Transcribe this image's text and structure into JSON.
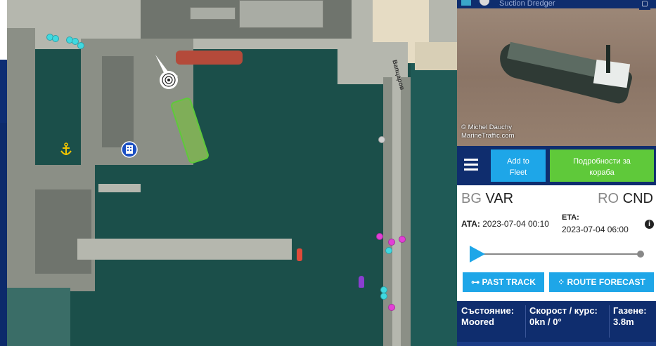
{
  "vessel": {
    "type_label": "Suction Dredger",
    "photo_credit": [
      "© Michel Dauchy",
      "MarineTraffic.com"
    ]
  },
  "actions": {
    "add_to_fleet": [
      "Add to",
      "Fleet"
    ],
    "details": [
      "Подробности за",
      "кораба"
    ],
    "past_track": "PAST TRACK",
    "route_forecast": "ROUTE FORECAST"
  },
  "route": {
    "from_country": "BG",
    "from_port": "VAR",
    "to_country": "RO",
    "to_port": "CND",
    "ata_label": "ATA:",
    "ata_value": "2023-07-04 00:10",
    "eta_label": "ETA:",
    "eta_value": "2023-07-04 06:00",
    "progress": 0.0
  },
  "status": {
    "state_label": "Състояние:",
    "state_value": "Moored",
    "speed_label": "Скорост / курс:",
    "speed_value": "0kn / 0°",
    "draught_label": "Газене:",
    "draught_value": "3.8m"
  },
  "map": {
    "road_label": "Вапцаров"
  },
  "colors": {
    "accent_blue": "#1ea6e8",
    "accent_green": "#5fc93a",
    "panel_navy": "#0f2d6e",
    "vessel_cyan": "#3fd9e0",
    "vessel_magenta": "#e23fd6"
  },
  "icons": [
    "menu-icon",
    "info-icon",
    "anchor-icon",
    "building-icon",
    "target-icon",
    "track-icon",
    "forecast-pin-icon",
    "expand-icon"
  ]
}
